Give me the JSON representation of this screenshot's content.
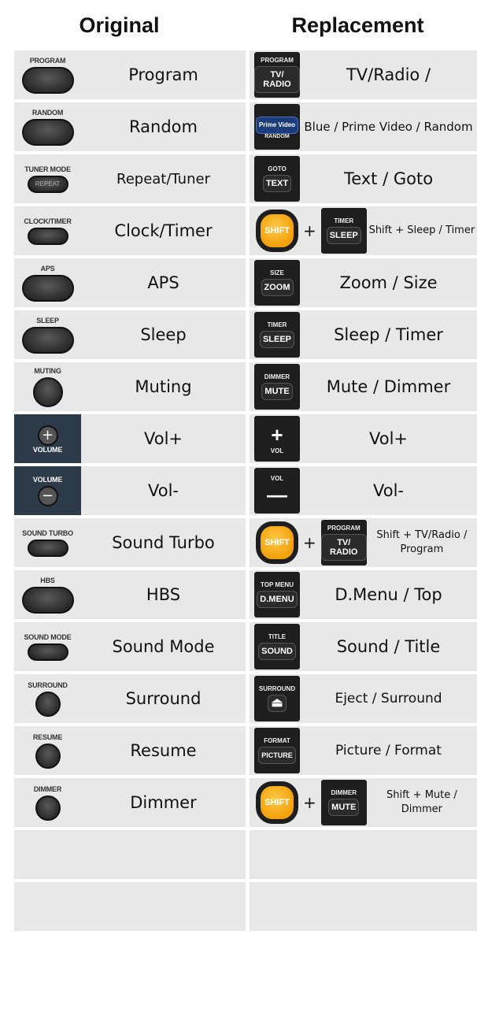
{
  "header": {
    "original": "Original",
    "replacement": "Replacement"
  },
  "rows": [
    {
      "orig_key": "PROGRAM",
      "orig": "Program",
      "repl_top": "PROGRAM",
      "repl_key": "TV/ RADIO",
      "repl": "TV/Radio /"
    },
    {
      "orig_key": "RANDOM",
      "orig": "Random",
      "repl_top": "Prime Video",
      "repl_key": "RANDOM",
      "repl": "Blue / Prime Video / Random"
    },
    {
      "orig_key": "TUNER MODE",
      "orig_btn": "REPEAT",
      "orig": "Repeat/Tuner",
      "repl_top": "GOTO",
      "repl_key": "TEXT",
      "repl": "Text / Goto"
    },
    {
      "orig_key": "CLOCK/TIMER",
      "orig": "Clock/Timer",
      "shift": "SHIFT",
      "plus": "+",
      "repl_top": "TIMER",
      "repl_key": "SLEEP",
      "repl": "Shift + Sleep / Timer"
    },
    {
      "orig_key": "APS",
      "orig": "APS",
      "repl_top": "SIZE",
      "repl_key": "ZOOM",
      "repl": "Zoom / Size"
    },
    {
      "orig_key": "SLEEP",
      "orig": "Sleep",
      "repl_top": "TIMER",
      "repl_key": "SLEEP",
      "repl": "Sleep / Timer"
    },
    {
      "orig_key": "MUTING",
      "orig": "Muting",
      "repl_top": "DIMMER",
      "repl_key": "MUTE",
      "repl": "Mute / Dimmer"
    },
    {
      "orig_key": "VOLUME",
      "orig": "Vol+",
      "repl_key": "+",
      "repl_bot": "VOL",
      "repl": "Vol+"
    },
    {
      "orig_key": "VOLUME",
      "orig": "Vol-",
      "repl_top": "VOL",
      "repl_key": "—",
      "repl": "Vol-"
    },
    {
      "orig_key": "SOUND TURBO",
      "orig": "Sound Turbo",
      "shift": "SHIFT",
      "plus": "+",
      "repl_top": "PROGRAM",
      "repl_key": "TV/ RADIO",
      "repl": "Shift + TV/Radio / Program"
    },
    {
      "orig_key": "HBS",
      "orig": "HBS",
      "repl_top": "TOP MENU",
      "repl_key": "D.MENU",
      "repl": "D.Menu / Top"
    },
    {
      "orig_key": "SOUND MODE",
      "orig": "Sound Mode",
      "repl_top": "TITLE",
      "repl_key": "SOUND",
      "repl": "Sound / Title"
    },
    {
      "orig_key": "SURROUND",
      "orig": "Surround",
      "repl_top": "SURROUND",
      "repl_key": "⏏",
      "repl": "Eject / Surround"
    },
    {
      "orig_key": "RESUME",
      "orig": "Resume",
      "repl_top": "FORMAT",
      "repl_key": "PICTURE",
      "repl": "Picture / Format"
    },
    {
      "orig_key": "DIMMER",
      "orig": "Dimmer",
      "shift": "SHIFT",
      "plus": "+",
      "repl_top": "DIMMER",
      "repl_key": "MUTE",
      "repl": "Shift + Mute / Dimmer"
    }
  ]
}
